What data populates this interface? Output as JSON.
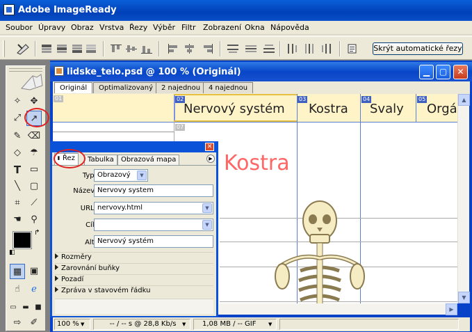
{
  "app": {
    "title": "Adobe ImageReady"
  },
  "menu": [
    "Soubor",
    "Úpravy",
    "Obraz",
    "Vrstva",
    "Řezy",
    "Výběr",
    "Filtr",
    "Zobrazení",
    "Okna",
    "Nápověda"
  ],
  "options_bar": {
    "hide_slices_button": "Skrýt automatické řezy"
  },
  "document": {
    "title": "lidske_telo.psd @ 100 % (Originál)",
    "tabs": [
      "Originál",
      "Optimalizovaný",
      "2 najednou",
      "4 najednou"
    ],
    "active_tab": "Originál",
    "banner": {
      "items": [
        "Nervový systém",
        "Kostra",
        "Svaly",
        "Orgá"
      ],
      "slice_numbers": [
        "01",
        "02",
        "03",
        "04",
        "05",
        "07"
      ]
    },
    "heading": "Kostra",
    "status": {
      "zoom": "100 %",
      "speed": "-- / -- s @ 28,8 Kb/s",
      "size": "1,08 MB / -- GIF"
    }
  },
  "palette": {
    "tabs": [
      "Řez",
      "Tabulka",
      "Obrazová mapa"
    ],
    "active_tab": "Řez",
    "fields": {
      "typ": {
        "label": "Typ:",
        "value": "Obrazový"
      },
      "nazev": {
        "label": "Název:",
        "value": "Nervovy system"
      },
      "url": {
        "label": "URL:",
        "value": "nervovy.html"
      },
      "cil": {
        "label": "Cíl:",
        "value": ""
      },
      "alt": {
        "label": "Alt:",
        "value": "Nervový systém"
      }
    },
    "sections": [
      "Rozměry",
      "Zarovnání buňky",
      "Pozadí",
      "Zpráva v stavovém řádku"
    ]
  },
  "toolbox": {
    "tools": [
      "marquee-icon",
      "move-icon",
      "lasso-icon",
      "magic-wand-icon",
      "slice-icon",
      "slice-select-icon",
      "brush-icon",
      "eraser-icon",
      "type-icon",
      "rectangle-icon",
      "line-icon",
      "rounded-rectangle-icon",
      "crop-icon",
      "eyedropper-icon",
      "hand-icon",
      "zoom-icon"
    ]
  },
  "colors": {
    "accent_blue": "#0a52d8",
    "banner_bg": "#fff3c8",
    "heading_red": "#ff6666",
    "highlight_red": "#e02020"
  }
}
